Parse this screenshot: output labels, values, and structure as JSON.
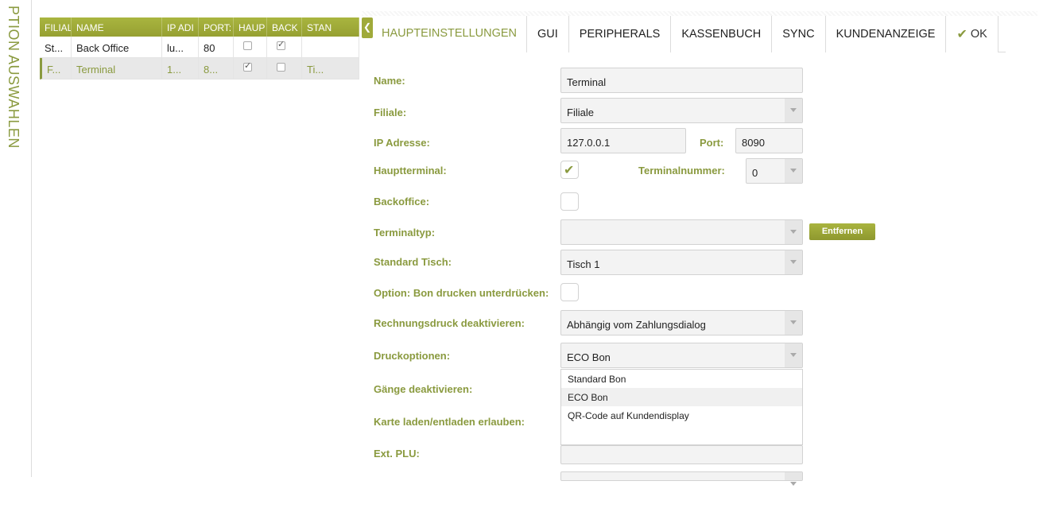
{
  "side_label": "PTION AUSWAHLEN",
  "grid": {
    "headers": [
      "FILIAL",
      "NAME",
      "IP ADI",
      "PORT:",
      "HAUP",
      "BACK",
      "STAN"
    ],
    "rows": [
      {
        "filiale": "St...",
        "name": "Back Office",
        "ip": "lu...",
        "port": "80",
        "haupt": false,
        "back": true,
        "stan": ""
      },
      {
        "filiale": "F...",
        "name": "Terminal",
        "ip": "1...",
        "port": "8...",
        "haupt": true,
        "back": false,
        "stan": "Ti..."
      }
    ]
  },
  "tabs": {
    "collapse_glyph": "❮",
    "items": [
      "HAUPTEINSTELLUNGEN",
      "GUI",
      "PERIPHERALS",
      "KASSENBUCH",
      "SYNC",
      "KUNDENANZEIGE"
    ],
    "ok_label": "OK",
    "ok_glyph": "✔"
  },
  "form": {
    "name_label": "Name:",
    "name_value": "Terminal",
    "filiale_label": "Filiale:",
    "filiale_value": "Filiale",
    "ip_label": "IP Adresse:",
    "ip_value": "127.0.0.1",
    "port_label": "Port:",
    "port_value": "8090",
    "hauptterminal_label": "Hauptterminal:",
    "hauptterminal_checked": true,
    "terminalnummer_label": "Terminalnummer:",
    "terminalnummer_value": "0",
    "backoffice_label": "Backoffice:",
    "backoffice_checked": false,
    "terminaltyp_label": "Terminaltyp:",
    "terminaltyp_value": "",
    "remove_button": "Entfernen",
    "standard_tisch_label": "Standard Tisch:",
    "standard_tisch_value": "Tisch 1",
    "bon_unterdruecken_label": "Option: Bon drucken unterdrücken:",
    "rechnungsdruck_label": "Rechnungsdruck deaktivieren:",
    "rechnungsdruck_value": "Abhängig vom Zahlungsdialog",
    "druckoptionen_label": "Druckoptionen:",
    "druckoptionen_value": "ECO Bon",
    "druckoptionen_options": [
      "Standard Bon",
      "ECO Bon",
      "QR-Code auf Kundendisplay"
    ],
    "gaenge_label": "Gänge deaktivieren:",
    "karte_label": "Karte laden/entladen erlauben:",
    "ext_plu_label": "Ext. PLU:",
    "ext_plu_value": ""
  },
  "colors": {
    "accent": "#8a9a3f",
    "header": "#a0aa3a"
  }
}
